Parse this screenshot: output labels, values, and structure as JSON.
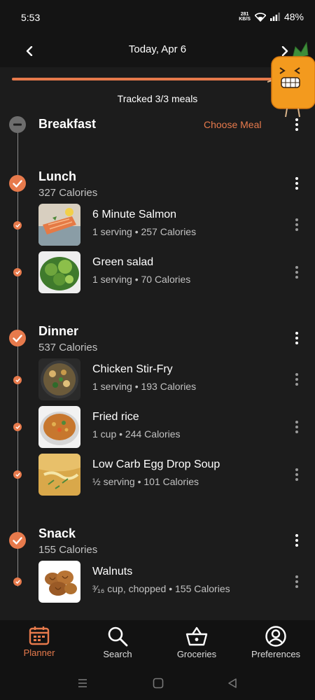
{
  "status": {
    "time": "5:53",
    "speed_value": "281",
    "speed_unit": "KB/S",
    "battery": "48%"
  },
  "header": {
    "date": "Today, Apr 6"
  },
  "tracked": "Tracked 3/3 meals",
  "meals": {
    "breakfast": {
      "title": "Breakfast",
      "action": "Choose Meal"
    },
    "lunch": {
      "title": "Lunch",
      "calories": "327 Calories",
      "items": [
        {
          "name": "6 Minute Salmon",
          "detail": "1 serving • 257 Calories"
        },
        {
          "name": "Green salad",
          "detail": "1 serving • 70 Calories"
        }
      ]
    },
    "dinner": {
      "title": "Dinner",
      "calories": "537 Calories",
      "items": [
        {
          "name": "Chicken Stir-Fry",
          "detail": "1 serving • 193 Calories"
        },
        {
          "name": "Fried rice",
          "detail": "1 cup • 244 Calories"
        },
        {
          "name": "Low Carb Egg Drop Soup",
          "detail": "½ serving • 101 Calories"
        }
      ]
    },
    "snack": {
      "title": "Snack",
      "calories": "155 Calories",
      "items": [
        {
          "name": "Walnuts",
          "detail": "³⁄₁₆ cup, chopped • 155 Calories"
        }
      ]
    }
  },
  "nav": {
    "planner": "Planner",
    "search": "Search",
    "groceries": "Groceries",
    "preferences": "Preferences",
    "active": "planner"
  },
  "colors": {
    "accent": "#e77a4c",
    "background": "#1c1c1c",
    "bar": "#141414"
  }
}
